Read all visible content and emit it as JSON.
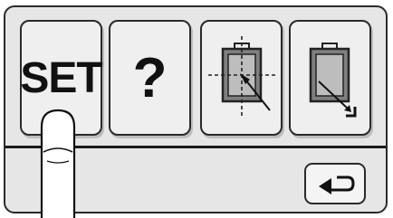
{
  "buttons": {
    "set_label": "SET",
    "help_label": "?"
  },
  "icons": {
    "center_button": "start-position-center-icon",
    "corner_button": "start-position-corner-icon",
    "back_button": "return-arrow-icon",
    "pointer": "finger-pointer-icon"
  },
  "colors": {
    "panel_bg": "#e6e6e6",
    "button_bg": "#efefef",
    "frame_fill": "#7f7f7f",
    "outline": "#2a2a2a"
  }
}
